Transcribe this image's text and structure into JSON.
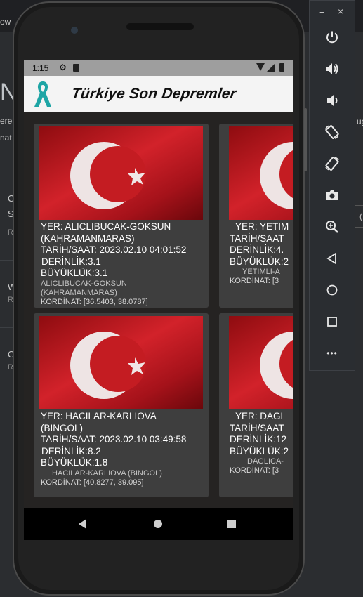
{
  "background": {
    "tab_fragment": "ow",
    "big_fragment": "No",
    "line_fragments": [
      "ere",
      "nat"
    ],
    "right_fragments": [
      "e",
      "ug"
    ],
    "left_items": [
      "C",
      "S",
      "R",
      "W",
      "R",
      "C",
      "R"
    ],
    "right_item": "("
  },
  "status_bar": {
    "time": "1:15"
  },
  "app": {
    "title": "Türkiye Son Depremler"
  },
  "cards": [
    {
      "place": "YER: ALICLIBUCAK-GOKSUN (KAHRAMANMARAS)",
      "place_line1": "YER: ALICLIBUCAK-GOKSUN",
      "place_line2": "(KAHRAMANMARAS)",
      "datetime": "TARİH/SAAT: 2023.02.10 04:01:52",
      "depth": "DERİNLİK:3.1",
      "magnitude": "BÜYÜKLÜK:3.1",
      "location_line1": "ALICLIBUCAK-GOKSUN",
      "location_line2": "(KAHRAMANMARAS)",
      "coordinates": "KORDİNAT: [36.5403, 38.0787]"
    },
    {
      "place_line1": "YER: YETIM",
      "place_line2": "",
      "datetime": "TARİH/SAAT",
      "depth": "DERİNLİK:4.",
      "magnitude": "BÜYÜKLÜK:2",
      "location_line1": "YETIMLI-A",
      "location_line2": "",
      "coordinates": "KORDİNAT: [3"
    },
    {
      "place_line1": "YER: HACILAR-KARLIOVA",
      "place_line2": "(BINGOL)",
      "datetime": "TARİH/SAAT: 2023.02.10 03:49:58",
      "depth": "DERİNLİK:8.2",
      "magnitude": "BÜYÜKLÜK:1.8",
      "location_line1": "HACILAR-KARLIOVA (BINGOL)",
      "location_line2": "",
      "coordinates": "KORDİNAT: [40.8277, 39.095]"
    },
    {
      "place_line1": "YER: DAGL",
      "place_line2": "",
      "datetime": "TARİH/SAAT",
      "depth": "DERİNLİK:12",
      "magnitude": "BÜYÜKLÜK:2",
      "location_line1": "DAGLICA-",
      "location_line2": "",
      "coordinates": "KORDİNAT: [3"
    }
  ],
  "colors": {
    "flag_red": "#c4161c",
    "ribbon": "#1ea5a5",
    "card_bg": "#3e3e3e",
    "toolbar_bg": "#2a2d31"
  },
  "emulator_toolbar": {
    "minimize": "−",
    "close": "×",
    "icons": [
      "power-icon",
      "volume-up-icon",
      "volume-down-icon",
      "rotate-left-icon",
      "rotate-right-icon",
      "camera-icon",
      "zoom-icon",
      "back-icon",
      "home-icon",
      "overview-icon",
      "more-icon"
    ],
    "more_label": "•••"
  }
}
